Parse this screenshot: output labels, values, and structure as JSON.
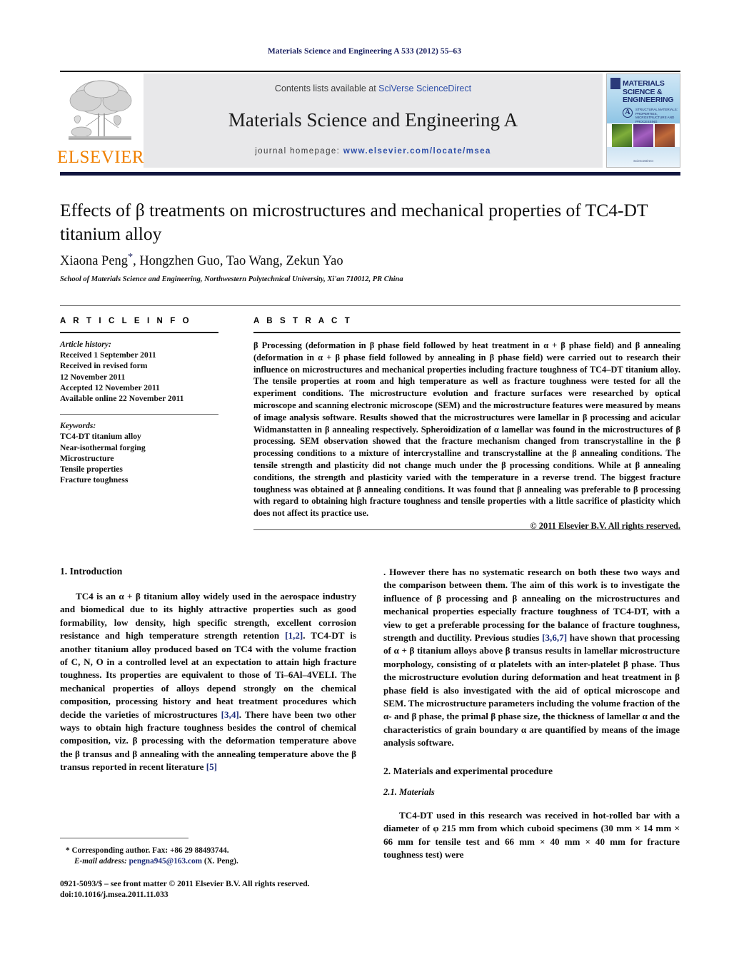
{
  "running_head": "Materials Science and Engineering A 533 (2012) 55–63",
  "masthead": {
    "publisher_logo_name": "elsevier-tree-logo",
    "publisher_wordmark": "ELSEVIER",
    "contents_prefix": "Contents lists available at ",
    "contents_link": "SciVerse ScienceDirect",
    "journal_title": "Materials Science and Engineering A",
    "homepage_prefix": "journal homepage: ",
    "homepage_url": "www.elsevier.com/locate/msea",
    "cover": {
      "title_lines": [
        "MATERIALS",
        "SCIENCE &",
        "ENGINEERING"
      ],
      "badge": "A",
      "subtitle": "STRUCTURAL MATERIALS: PROPERTIES, MICROSTRUCTURE AND PROCESSING",
      "footer": "ScienceDirect"
    },
    "accent_bar_color": "#12163f",
    "banner_bg_color": "#e8e8ea",
    "link_color": "#2d4ea8",
    "elsevier_orange": "#F08000"
  },
  "article": {
    "title": "Effects of β treatments on microstructures and mechanical properties of TC4-DT titanium alloy",
    "authors": "Xiaona Peng",
    "authors_rest": ", Hongzhen Guo, Tao Wang, Zekun Yao",
    "author_star": "*",
    "affiliation": "School of Materials Science and Engineering, Northwestern Polytechnical University, Xi'an 710012, PR China"
  },
  "info": {
    "heading": "A R T I C L E    I N F O",
    "history_label": "Article history:",
    "history": [
      "Received 1 September 2011",
      "Received in revised form",
      "12 November 2011",
      "Accepted 12 November 2011",
      "Available online 22 November 2011"
    ],
    "keywords_label": "Keywords:",
    "keywords": [
      "TC4-DT titanium alloy",
      "Near-isothermal forging",
      "Microstructure",
      "Tensile properties",
      "Fracture toughness"
    ]
  },
  "abstract": {
    "heading": "A B S T R A C T",
    "text": "β Processing (deformation in β phase field followed by heat treatment in α + β phase field) and β annealing (deformation in α + β phase field followed by annealing in β phase field) were carried out to research their influence on microstructures and mechanical properties including fracture toughness of TC4–DT titanium alloy. The tensile properties at room and high temperature as well as fracture toughness were tested for all the experiment conditions. The microstructure evolution and fracture surfaces were researched by optical microscope and scanning electronic microscope (SEM) and the microstructure features were measured by means of image analysis software. Results showed that the microstructures were lamellar in β processing and acicular Widmanstatten in β annealing respectively. Spheroidization of α lamellar was found in the microstructures of β processing. SEM observation showed that the fracture mechanism changed from transcrystalline in the β processing conditions to a mixture of intercrystalline and transcrystalline at the β annealing conditions. The tensile strength and plasticity did not change much under the β processing conditions. While at β annealing conditions, the strength and plasticity varied with the temperature in a reverse trend. The biggest fracture toughness was obtained at β annealing conditions. It was found that β annealing was preferable to β processing with regard to obtaining high fracture toughness and tensile properties with a little sacrifice of plasticity which does not affect its practice use.",
    "copyright": "© 2011 Elsevier B.V. All rights reserved."
  },
  "sections": {
    "intro_heading": "1. Introduction",
    "intro_p1_a": "TC4 is an α + β titanium alloy widely used in the aerospace industry and biomedical due to its highly attractive properties such as good formability, low density, high specific strength, excellent corrosion resistance and high temperature strength retention ",
    "intro_ref_12": "[1,2]",
    "intro_p1_b": ". TC4-DT is another titanium alloy produced based on TC4 with the volume fraction of C, N, O in a controlled level at an expectation to attain high fracture toughness. Its properties are equivalent to those of Ti–6Al–4VELI. The mechanical properties of alloys depend strongly on the chemical composition, processing history and heat treatment procedures which decide the varieties of microstructures ",
    "intro_ref_34": "[3,4]",
    "intro_p1_c": ". There have been two other ways to obtain high fracture toughness besides the control of chemical composition, viz. β processing with the deformation temperature above the β transus and β annealing with the annealing temperature above the β transus reported in recent literature ",
    "intro_ref_5": "[5]",
    "intro_p1_d": ". However there has no systematic research on both these two ways and the comparison between them. The aim of this work is to investigate the influence of β processing and β annealing on the microstructures and mechanical properties especially fracture toughness of TC4-DT, with a view to get a preferable processing for the balance of fracture toughness, strength and ductility. Previous studies ",
    "intro_ref_367": "[3,6,7]",
    "intro_p1_e": " have shown that processing of α + β titanium alloys above β transus results in lamellar microstructure morphology, consisting of α platelets with an inter-platelet β phase. Thus the microstructure evolution during deformation and heat treatment in β phase field is also investigated with the aid of optical microscope and SEM. The microstructure parameters including the volume fraction of the α- and β phase, the primal β phase size, the thickness of lamellar α and the characteristics of grain boundary α are quantified by means of the image analysis software.",
    "materials_heading": "2. Materials and experimental procedure",
    "materials_subheading": "2.1. Materials",
    "materials_p1": "TC4-DT used in this research was received in hot-rolled bar with a diameter of φ 215 mm from which cuboid specimens (30 mm × 14 mm × 66 mm for tensile test and 66 mm × 40 mm × 40 mm for fracture toughness test) were"
  },
  "footnotes": {
    "corresponding": "* Corresponding author. Fax: +86 29 88493744.",
    "email_label": "E-mail address:",
    "email": "pengna945@163.com",
    "email_suffix": " (X. Peng).",
    "front_matter": "0921-5093/$ – see front matter © 2011 Elsevier B.V. All rights reserved.",
    "doi": "doi:10.1016/j.msea.2011.11.033"
  }
}
